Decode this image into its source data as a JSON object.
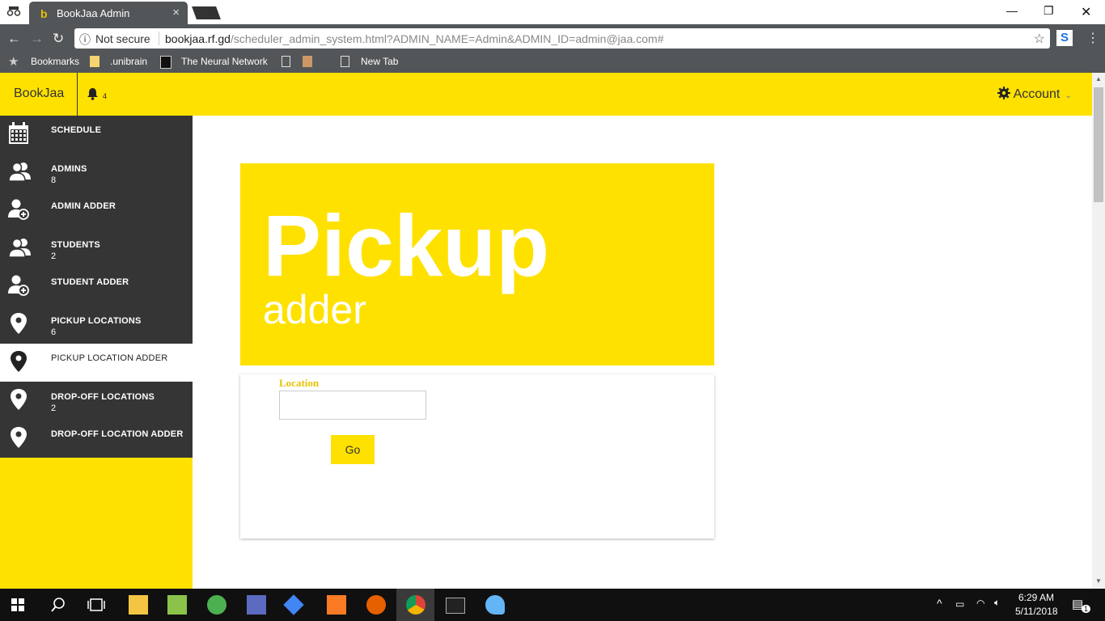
{
  "browser": {
    "tab_title": "BookJaa Admin",
    "tab_close": "×",
    "security": "Not secure",
    "url_host": "bookjaa.rf.gd",
    "url_path": "/scheduler_admin_system.html?ADMIN_NAME=Admin&ADMIN_ID=admin@jaa.com#",
    "bookmarks": [
      "Bookmarks",
      ".unibrain",
      "The Neural Network",
      "New Tab"
    ]
  },
  "appbar": {
    "brand": "BookJaa",
    "notif_count": "4",
    "account": "Account"
  },
  "sidebar": {
    "items": [
      {
        "label": "SCHEDULE",
        "count": "",
        "icon": "calendar-icon"
      },
      {
        "label": "ADMINS",
        "count": "8",
        "icon": "users-icon"
      },
      {
        "label": "ADMIN ADDER",
        "count": "",
        "icon": "user-add-icon"
      },
      {
        "label": "STUDENTS",
        "count": "2",
        "icon": "users-icon"
      },
      {
        "label": "STUDENT ADDER",
        "count": "",
        "icon": "user-add-icon"
      },
      {
        "label": "PICKUP LOCATIONS",
        "count": "6",
        "icon": "location-pin-icon"
      },
      {
        "label": "PICKUP LOCATION ADDER",
        "count": "",
        "icon": "location-pin-icon"
      },
      {
        "label": "DROP-OFF LOCATIONS",
        "count": "2",
        "icon": "location-pin-icon"
      },
      {
        "label": "DROP-OFF LOCATION ADDER",
        "count": "",
        "icon": "location-pin-icon"
      }
    ],
    "active_index": 6
  },
  "hero": {
    "title": "Pickup",
    "subtitle": "adder"
  },
  "form": {
    "location_label": "Location",
    "location_value": "",
    "go_label": "Go"
  },
  "taskbar": {
    "time": "6:29 AM",
    "date": "5/11/2018",
    "notifications": "1"
  },
  "colors": {
    "accent": "#ffe100",
    "sidebar": "#353535"
  }
}
